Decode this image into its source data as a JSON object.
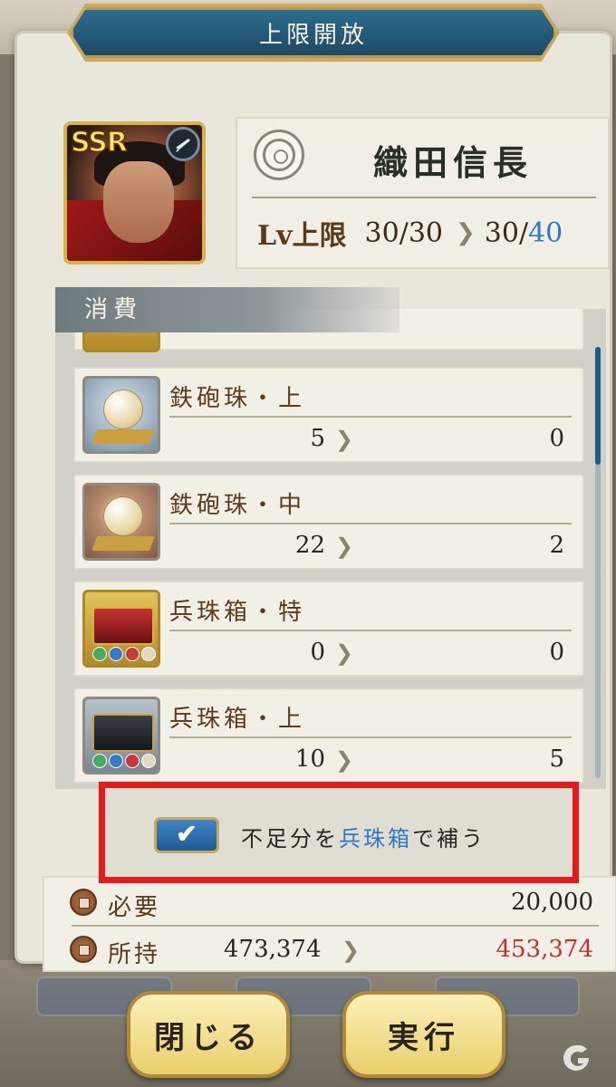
{
  "window": {
    "title": "上限開放"
  },
  "character": {
    "rarity": "SSR",
    "weapon_icon": "musket-icon",
    "name": "織田信長",
    "level_label": "Lv上限",
    "level_current": "30/30",
    "level_next_prefix": "30/",
    "level_next_cap": "40"
  },
  "section": {
    "consume_label": "消費"
  },
  "items": [
    {
      "name": "鉄砲珠・上",
      "from": "5",
      "to": "0",
      "icon": "musket-orb-upper-icon"
    },
    {
      "name": "鉄砲珠・中",
      "from": "22",
      "to": "2",
      "icon": "musket-orb-middle-icon"
    },
    {
      "name": "兵珠箱・特",
      "from": "0",
      "to": "0",
      "icon": "soldier-orb-box-special-icon"
    },
    {
      "name": "兵珠箱・上",
      "from": "10",
      "to": "5",
      "icon": "soldier-orb-box-upper-icon"
    }
  ],
  "supplement": {
    "checked": true,
    "label_pre": "不足分を",
    "label_highlight": "兵珠箱",
    "label_post": "で補う",
    "highlight_color": "#2f78c8"
  },
  "cost": {
    "required_label": "必要",
    "required_value": "20,000",
    "owned_label": "所持",
    "owned_value": "473,374",
    "owned_after": "453,374",
    "after_color": "#c43030"
  },
  "buttons": {
    "close_label": "閉じる",
    "execute_label": "実行"
  },
  "colors": {
    "title_bar": "#1c4b66",
    "accent_blue": "#2f78c8",
    "highlight_border": "#e51a1a"
  }
}
